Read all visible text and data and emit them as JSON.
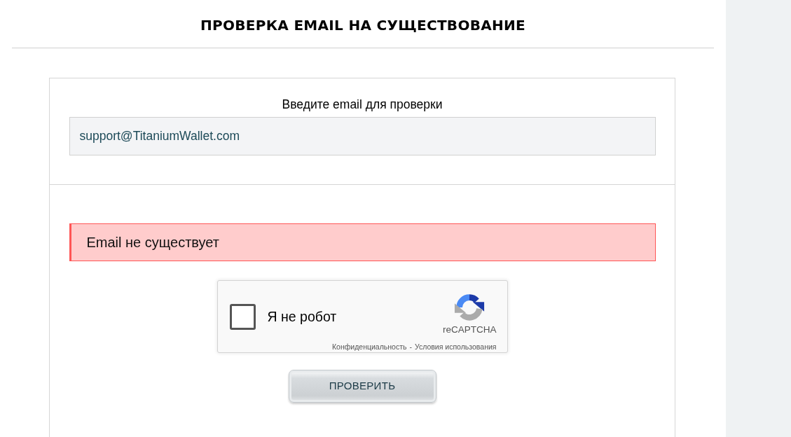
{
  "page": {
    "title": "ПРОВЕРКА EMAIL НА СУЩЕСТВОВАНИЕ"
  },
  "form": {
    "label": "Введите email для проверки",
    "email_field": {
      "value": "support@TitaniumWallet.com"
    }
  },
  "alert": {
    "kind": "error",
    "message": "Email не существует"
  },
  "captcha": {
    "checked": false,
    "label": "Я не робот",
    "brand": "reCAPTCHA",
    "links": [
      {
        "label": "Конфиденциальность"
      },
      {
        "label": "Условия использования"
      }
    ],
    "separator": "-"
  },
  "submit_button": {
    "label": "ПРОВЕРИТЬ"
  }
}
